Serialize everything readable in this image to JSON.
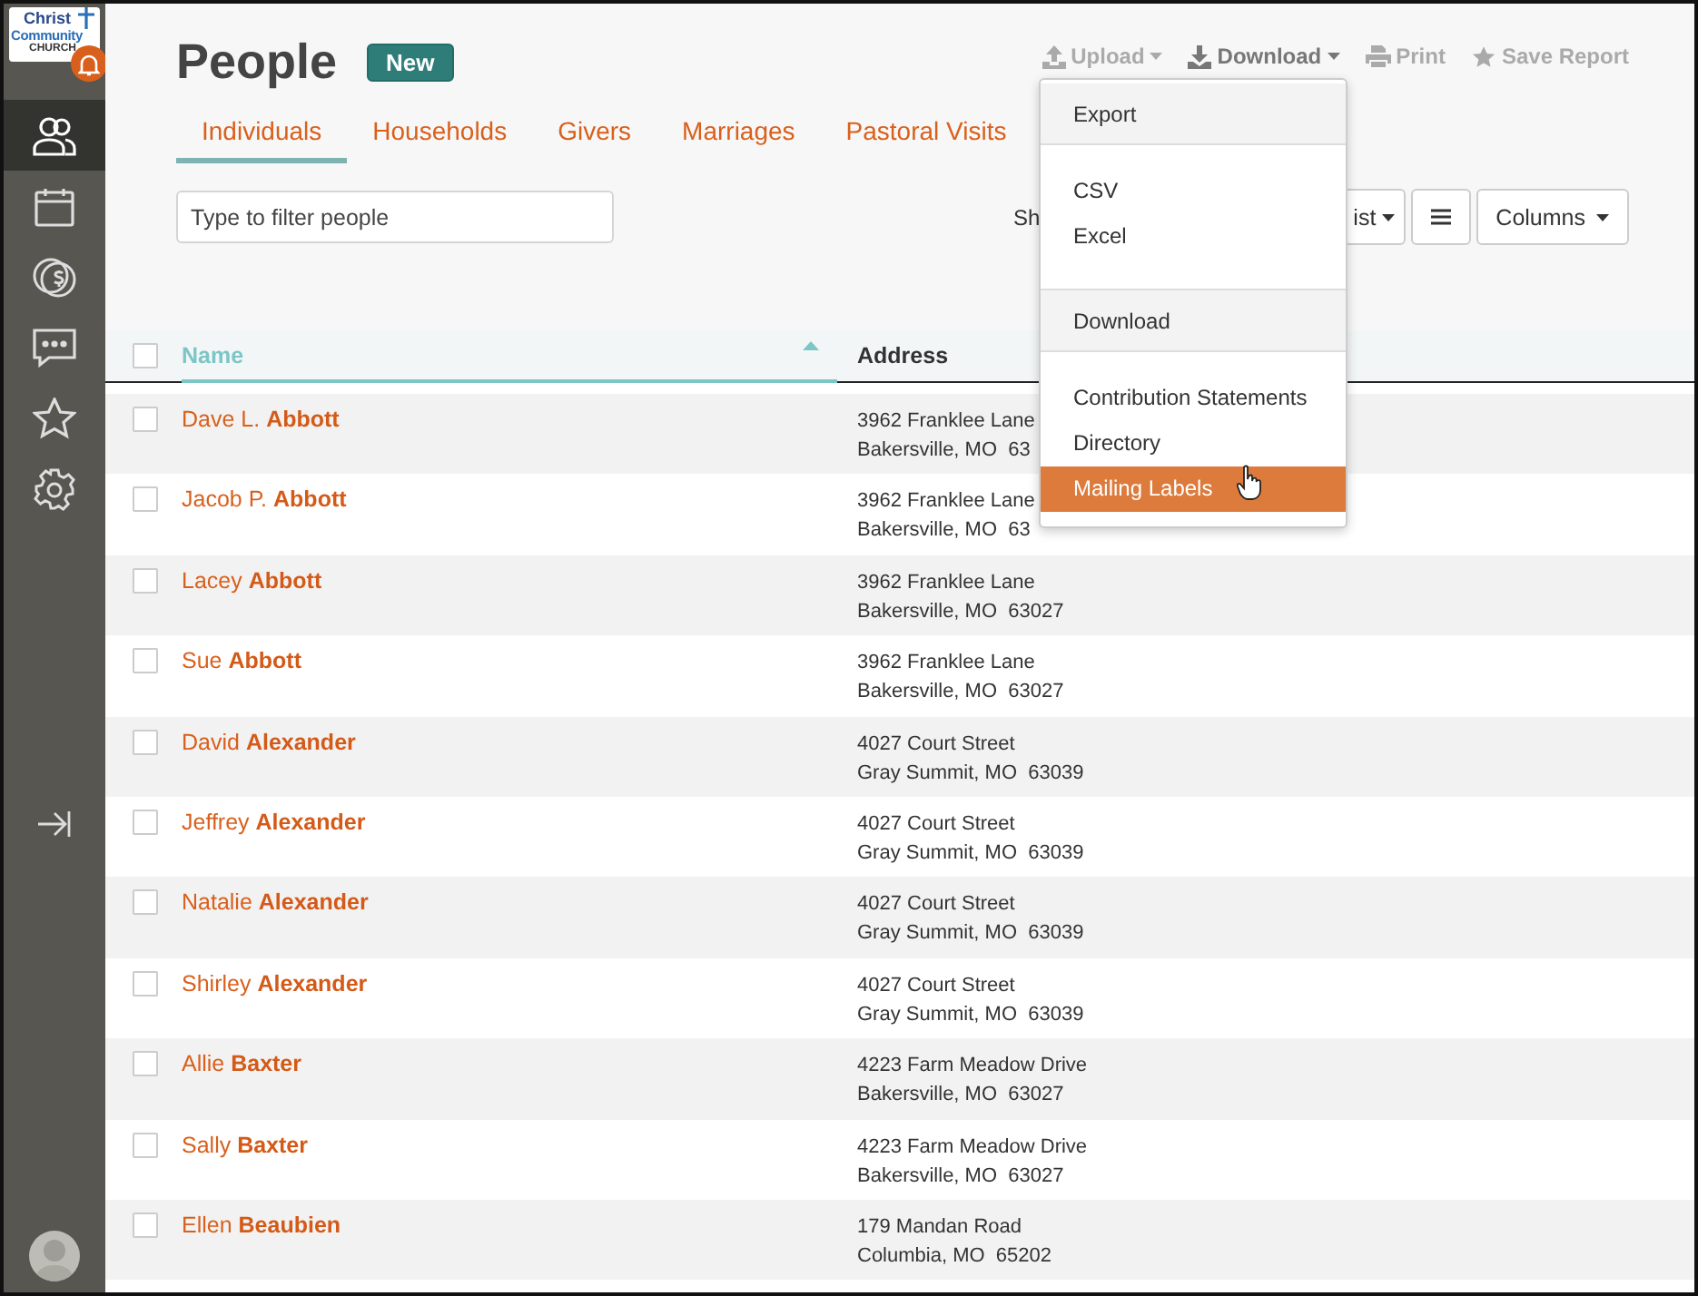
{
  "sidebar": {
    "logo": {
      "line_1": "Christ",
      "line_2": "Community",
      "line_3": "CHURCH"
    },
    "notifications": true,
    "items": [
      {
        "kind": "people",
        "selected": true
      },
      {
        "kind": "calendar",
        "selected": false
      },
      {
        "kind": "giving",
        "selected": false
      },
      {
        "kind": "messages",
        "selected": false
      },
      {
        "kind": "favorites",
        "selected": false
      },
      {
        "kind": "settings",
        "selected": false
      }
    ]
  },
  "page": {
    "title": "People",
    "new_button": "New"
  },
  "tabs": [
    {
      "label": "Individuals",
      "selected": true
    },
    {
      "label": "Households",
      "selected": false
    },
    {
      "label": "Givers",
      "selected": false
    },
    {
      "label": "Marriages",
      "selected": false
    },
    {
      "label": "Pastoral Visits",
      "selected": false
    }
  ],
  "toolbar": [
    {
      "kind": "upload",
      "label": "Upload",
      "expanded": false
    },
    {
      "kind": "download",
      "label": "Download",
      "expanded": true
    },
    {
      "kind": "print",
      "label": "Print"
    },
    {
      "kind": "save",
      "label": "Save Report"
    }
  ],
  "filter": {
    "placeholder": "Type to filter people"
  },
  "view_controls": {
    "show_label": "Sh",
    "view_select": "ist",
    "columns_button": "Columns"
  },
  "table": {
    "all_checked": false,
    "columns": [
      "Name",
      "Address"
    ],
    "rows": [
      {
        "name": "Dave L. **Abbott**",
        "address_1": "3962 Franklee Lane",
        "address_2": "Bakersville, MO  63",
        "checked": false
      },
      {
        "name": "Jacob P. **Abbott**",
        "address_1": "3962 Franklee Lane",
        "address_2": "Bakersville, MO  63",
        "checked": false
      },
      {
        "name": "Lacey **Abbott**",
        "address_1": "3962 Franklee Lane",
        "address_2": "Bakersville, MO  63027",
        "checked": false
      },
      {
        "name": "Sue **Abbott**",
        "address_1": "3962 Franklee Lane",
        "address_2": "Bakersville, MO  63027",
        "checked": false
      },
      {
        "name": "David **Alexander**",
        "address_1": "4027 Court Street",
        "address_2": "Gray Summit, MO  63039",
        "checked": false
      },
      {
        "name": "Jeffrey **Alexander**",
        "address_1": "4027 Court Street",
        "address_2": "Gray Summit, MO  63039",
        "checked": false
      },
      {
        "name": "Natalie **Alexander**",
        "address_1": "4027 Court Street",
        "address_2": "Gray Summit, MO  63039",
        "checked": false
      },
      {
        "name": "Shirley **Alexander**",
        "address_1": "4027 Court Street",
        "address_2": "Gray Summit, MO  63039",
        "checked": false
      },
      {
        "name": "Allie **Baxter**",
        "address_1": "4223 Farm Meadow Drive",
        "address_2": "Bakersville, MO  63027",
        "checked": false
      },
      {
        "name": "Sally **Baxter**",
        "address_1": "4223 Farm Meadow Drive",
        "address_2": "Bakersville, MO  63027",
        "checked": false
      },
      {
        "name": "Ellen **Beaubien**",
        "address_1": "179 Mandan Road",
        "address_2": "Columbia, MO  65202",
        "checked": false
      }
    ]
  },
  "download_menu": [
    {
      "kind": "header",
      "label": "Export"
    },
    {
      "kind": "item",
      "label": "CSV",
      "selected": false
    },
    {
      "kind": "item",
      "label": "Excel",
      "selected": false
    },
    {
      "kind": "header",
      "label": "Download"
    },
    {
      "kind": "item",
      "label": "Contribution Statements",
      "selected": false
    },
    {
      "kind": "item",
      "label": "Directory",
      "selected": false
    },
    {
      "kind": "item",
      "label": "Mailing Labels",
      "selected": true
    }
  ]
}
